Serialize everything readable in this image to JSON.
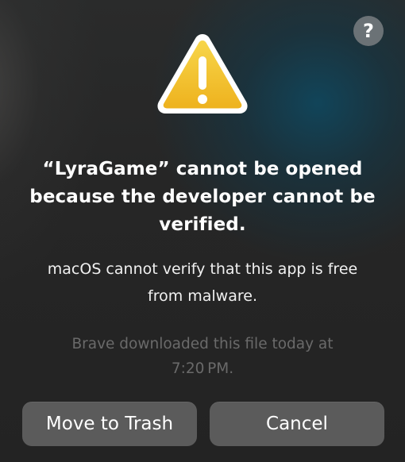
{
  "dialog": {
    "help_label": "?",
    "icon": "warning-triangle-icon",
    "title_lines": [
      "“LyraGame” cannot be opened",
      "because the developer cannot be",
      "verified."
    ],
    "message_lines": [
      "macOS cannot verify that this app is free",
      "from malware."
    ],
    "download_info_lines": [
      "Brave downloaded this file today at",
      "7:20 PM."
    ],
    "buttons": {
      "move_to_trash": "Move to Trash",
      "cancel": "Cancel"
    }
  },
  "colors": {
    "warning_fill": "#f2c230",
    "warning_border": "#ffffff",
    "button_bg": "#5b5b5b",
    "muted_text": "#6a6a6a",
    "help_bg": "#6b7276"
  }
}
